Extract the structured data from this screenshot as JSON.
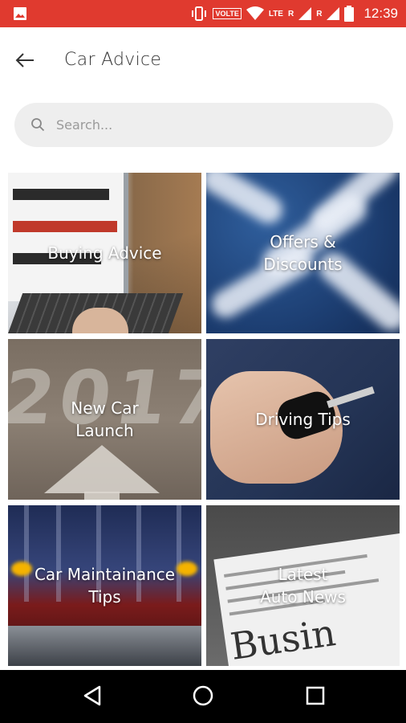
{
  "status_bar": {
    "time": "12:39",
    "volte": "VOLTE",
    "lte": "LTE",
    "r1": "R",
    "r2": "R",
    "icons": [
      "image-icon",
      "vibrate-icon",
      "wifi-icon",
      "signal-icon",
      "battery-icon"
    ]
  },
  "header": {
    "title": "Car Advice",
    "back_icon": "back-arrow-icon"
  },
  "search": {
    "placeholder": "Search...",
    "value": ""
  },
  "tiles": [
    {
      "label": "Buying Advice"
    },
    {
      "label": "Offers &\nDiscounts"
    },
    {
      "label": "New Car\nLaunch"
    },
    {
      "label": "Driving Tips"
    },
    {
      "label": "Car Maintainance\nTips"
    },
    {
      "label": "Latest\nAuto News"
    }
  ],
  "nav": {
    "icons": [
      "back-triangle-icon",
      "home-circle-icon",
      "recents-square-icon"
    ]
  },
  "colors": {
    "status_bar": "#e03a2f",
    "search_bg": "#eeeeee",
    "nav_bar": "#000000"
  }
}
